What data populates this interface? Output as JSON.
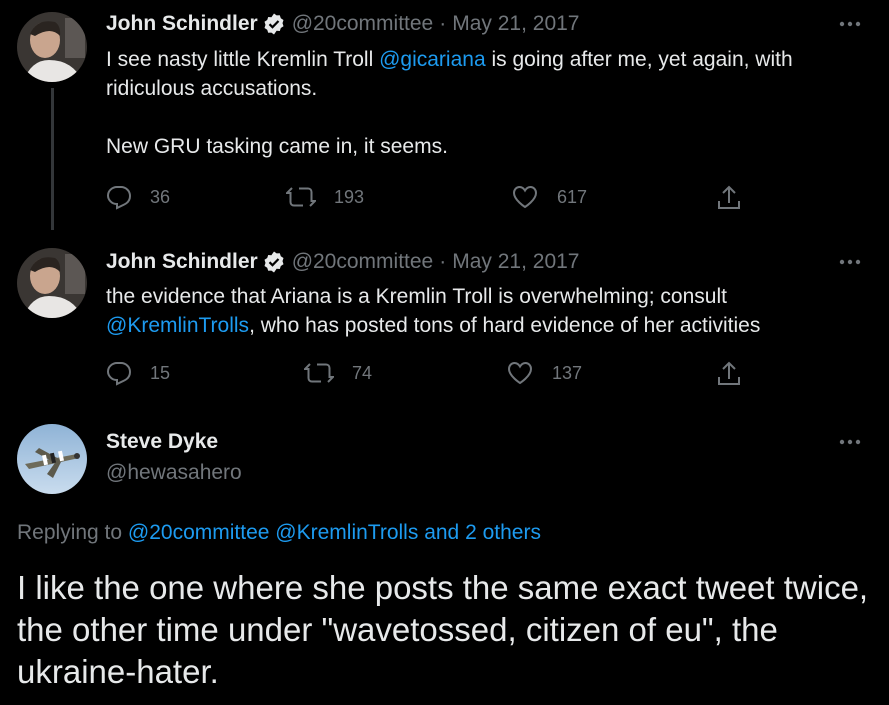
{
  "tweets": [
    {
      "author_name": "John Schindler",
      "handle": "@20committee",
      "separator": "·",
      "date": "May 21, 2017",
      "text_before": "I see nasty little Kremlin Troll ",
      "mention": "@gicariana",
      "text_after": " is going after me, yet again, with ridiculous accusations.",
      "paragraph2": "New GRU tasking came in, it seems.",
      "replies": "36",
      "retweets": "193",
      "likes": "617"
    },
    {
      "author_name": "John Schindler",
      "handle": "@20committee",
      "separator": "·",
      "date": "May 21, 2017",
      "text_before": "the evidence that Ariana is a Kremlin Troll is overwhelming; consult ",
      "mention": "@KremlinTrolls",
      "text_after": ", who has posted tons of hard evidence of her activities",
      "replies": "15",
      "retweets": "74",
      "likes": "137"
    }
  ],
  "main_tweet": {
    "author_name": "Steve Dyke",
    "handle": "@hewasahero",
    "replying_prefix": "Replying to ",
    "replying_1": "@20committee",
    "replying_2": "@KremlinTrolls",
    "replying_3": "and 2 others",
    "text": "I like the one where she posts the same exact tweet twice, the other time under \"wavetossed, citizen of eu\", the ukraine-hater."
  },
  "icons": {
    "verified": "verified-badge-icon",
    "more": "more-dots-icon",
    "reply": "reply-icon",
    "retweet": "retweet-icon",
    "like": "heart-icon",
    "share": "share-icon"
  },
  "colors": {
    "background": "#000000",
    "text": "#e7e9ea",
    "muted": "#71767b",
    "link": "#1d9bf0"
  }
}
